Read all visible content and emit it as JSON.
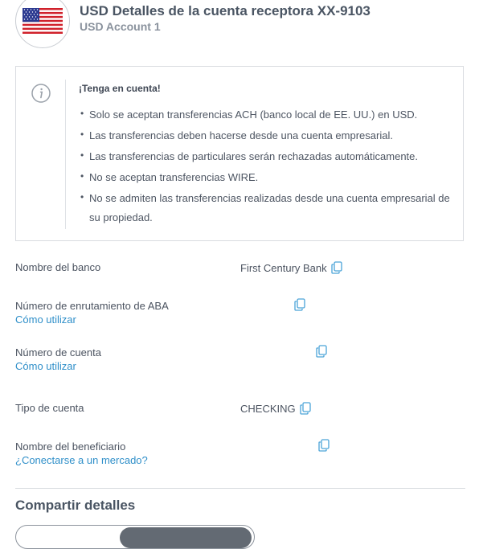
{
  "header": {
    "flag_icon": "us-flag-icon",
    "title": "USD Detalles de la cuenta receptora XX-9103",
    "subtitle": "USD Account 1"
  },
  "notice": {
    "icon": "info-icon",
    "title": "¡Tenga en cuenta!",
    "items": [
      "Solo se aceptan transferencias ACH (banco local de EE. UU.) en USD.",
      "Las transferencias deben hacerse desde una cuenta empresarial.",
      "Las transferencias de particulares serán rechazadas automáticamente.",
      "No se aceptan transferencias WIRE.",
      "No se admiten las transferencias realizadas desde una cuenta empresarial de su propiedad."
    ]
  },
  "details": [
    {
      "label": "Nombre del banco",
      "value": "First Century Bank",
      "link": ""
    },
    {
      "label": "Número de enrutamiento de ABA",
      "value": "",
      "link": "Cómo utilizar"
    },
    {
      "label": "Número de cuenta",
      "value": "",
      "link": "Cómo utilizar"
    },
    {
      "label": "Tipo de cuenta",
      "value": "CHECKING",
      "link": ""
    },
    {
      "label": "Nombre del beneficiario",
      "value": "",
      "link": "¿Conectarse a un mercado?"
    }
  ],
  "share": {
    "title": "Compartir detalles"
  },
  "colors": {
    "link": "#2f8fc9",
    "copy_icon": "#4aa3d8",
    "text": "#4b5360"
  }
}
